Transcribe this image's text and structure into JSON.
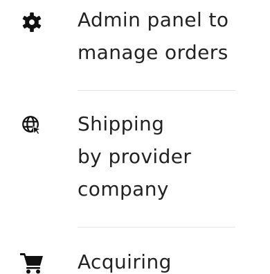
{
  "features": [
    {
      "icon": "gear-icon",
      "lines": [
        "Admin panel to",
        "manage orders"
      ]
    },
    {
      "icon": "globe-icon",
      "lines": [
        "Shipping",
        "by provider",
        "company"
      ]
    },
    {
      "icon": "cart-icon",
      "lines": [
        "Acquiring"
      ]
    }
  ],
  "colors": {
    "text": "#222222",
    "icon": "#111111",
    "divider": "#e4e4e4"
  }
}
